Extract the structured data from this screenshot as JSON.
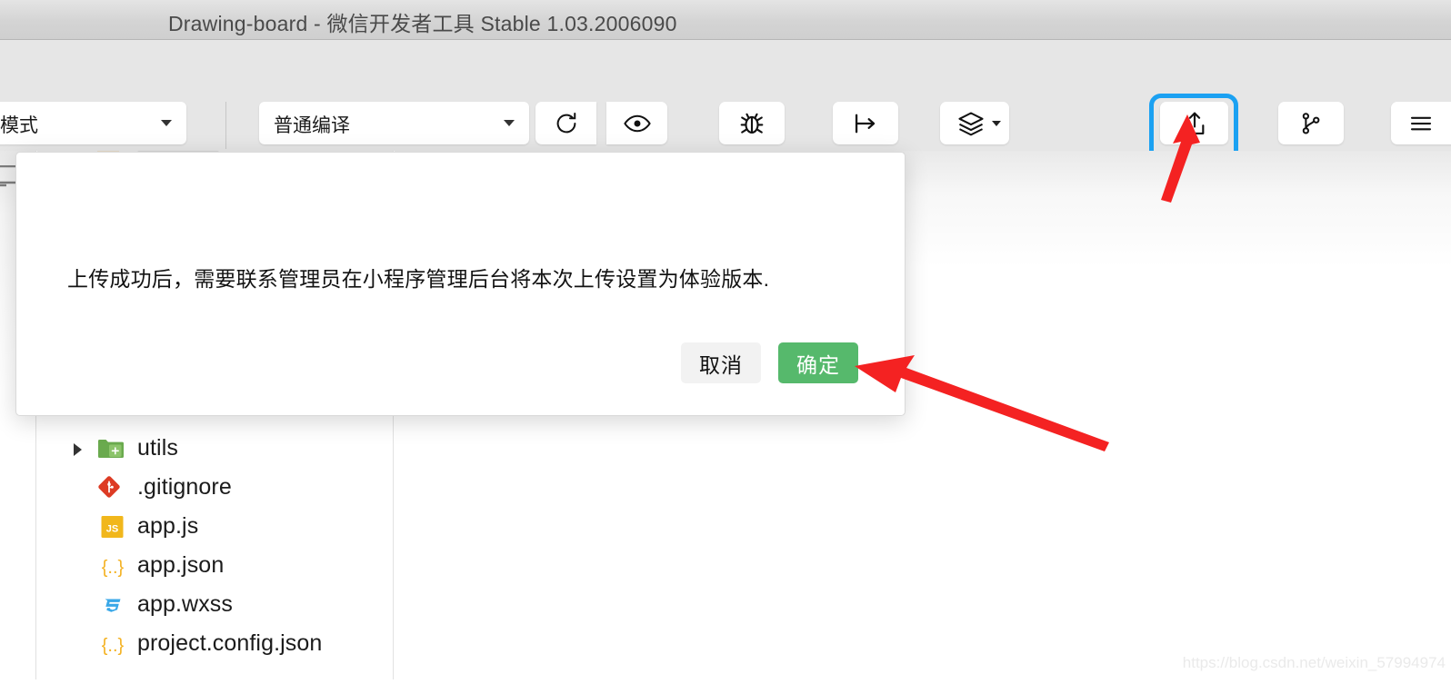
{
  "window": {
    "title": "Drawing-board - 微信开发者工具 Stable 1.03.2006090"
  },
  "toolbar": {
    "mode_select": {
      "value": "模式",
      "icon": "chevron-down-icon"
    },
    "compile_select": {
      "value": "普通编译",
      "icon": "chevron-down-icon"
    },
    "buttons": [
      {
        "label": "编译",
        "icon": "refresh-icon"
      },
      {
        "label": "预览",
        "icon": "eye-icon"
      },
      {
        "label": "真机调试",
        "icon": "bug-icon"
      },
      {
        "label": "切后台",
        "icon": "switch-background-icon"
      },
      {
        "label": "清缓存",
        "icon": "layers-icon"
      },
      {
        "label": "上传",
        "icon": "upload-icon"
      },
      {
        "label": "版本管理",
        "icon": "git-branch-icon"
      },
      {
        "label": "详",
        "icon": "details-icon"
      }
    ],
    "highlight_color": "#1ba1f2",
    "highlighted_button": "上传"
  },
  "sidebar": {
    "rail_icon": "simulator-icon"
  },
  "filetree": {
    "items": [
      {
        "name": "utils",
        "icon": "folder-icon",
        "expandable": true
      },
      {
        "name": ".gitignore",
        "icon": "git-icon",
        "expandable": false
      },
      {
        "name": "app.js",
        "icon": "js-icon",
        "expandable": false
      },
      {
        "name": "app.json",
        "icon": "json-icon",
        "expandable": false
      },
      {
        "name": "app.wxss",
        "icon": "css-icon",
        "expandable": false
      },
      {
        "name": "project.config.json",
        "icon": "json-icon",
        "expandable": false
      }
    ]
  },
  "modal": {
    "message": "上传成功后，需要联系管理员在小程序管理后台将本次上传设置为体验版本.",
    "cancel_label": "取消",
    "confirm_label": "确定",
    "confirm_color": "#56b96c"
  },
  "annotations": {
    "arrow_color": "#f42222",
    "arrows": [
      {
        "name": "arrow-to-upload-button",
        "points_to": "上传"
      },
      {
        "name": "arrow-to-confirm-button",
        "points_to": "确定"
      }
    ]
  },
  "watermark": {
    "text": "https://blog.csdn.net/weixin_57994974"
  }
}
